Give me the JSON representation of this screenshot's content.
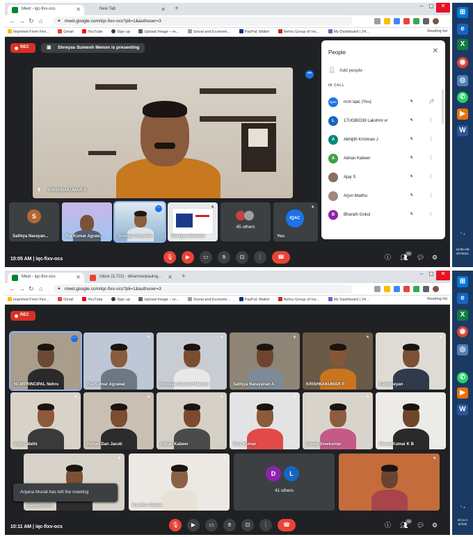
{
  "screens": [
    {
      "tabs": [
        {
          "title": "Meet - iqc-fixv-ocs"
        },
        {
          "title": "New Tab"
        }
      ],
      "url": "meet.google.com/iqc-fixv-ocs?pli=1&authuser=3",
      "bookmarks": [
        "Imported From Fire...",
        "Gmail",
        "YouTube",
        "Sign up",
        "Upload Image – re...",
        "Social and Economi...",
        "PayPal: Wallet",
        "Nehru Group of Ins...",
        "My Dashboard | 24..."
      ],
      "reading_list": "Reading list",
      "rec_label": "REC",
      "presenting_banner": "Shreyas Sumesh Menon is presenting",
      "main_speaker": "KRISHNAKUMAR P",
      "tiles": [
        {
          "name": "Sathiya Narayan...",
          "letter": "S"
        },
        {
          "name": "Raj Kumar Agraw..."
        },
        {
          "name": "Shreyas Sumesh"
        },
        {
          "name": "Shreyas Sumesh"
        },
        {
          "name": "45 others"
        },
        {
          "name": "You",
          "letter": "IQAC"
        }
      ],
      "time": "10:05 AM",
      "meeting_code": "iqc-fixv-ocs",
      "participant_count": "61",
      "people_panel": {
        "title": "People",
        "add_people": "Add people",
        "section": "IN CALL",
        "members": [
          {
            "name": "ncm iqac (You)",
            "avatar": "IQAC",
            "color": "#1a73e8"
          },
          {
            "name": "17UGBIO38 Lakshmi vr",
            "avatar": "L",
            "color": "#1565c0"
          },
          {
            "name": "Abhijith Krishnan J",
            "avatar": "A",
            "color": "#00897b"
          },
          {
            "name": "Adnan Kabeer",
            "avatar": "A",
            "color": "#43a047"
          },
          {
            "name": "Ajay S",
            "avatar": "",
            "color": "#8d6e63"
          },
          {
            "name": "Arjun Madhu",
            "avatar": "",
            "color": "#a1887f"
          },
          {
            "name": "Bharath Gokul",
            "avatar": "B",
            "color": "#8e24aa"
          }
        ]
      },
      "taskbar_clock": [
        "10:05 AM",
        "6/7/2021"
      ]
    },
    {
      "tabs": [
        {
          "title": "Meet - iqc-fixv-ocs"
        },
        {
          "title": "Inbox (3,722) - drkarmanpaulraj..."
        }
      ],
      "url": "meet.google.com/iqc-fixv-ocs?pli=1&authuser=3",
      "bookmarks": [
        "Imported From Fire...",
        "Gmail",
        "YouTube",
        "Sign up",
        "Upload Image – re...",
        "Social and Economi...",
        "PayPal: Wallet",
        "Nehru Group of Ins...",
        "My Dashboard | 24..."
      ],
      "reading_list": "Reading list",
      "rec_label": "REC",
      "grid": [
        {
          "name": "NCMPRINCIPAL Nehru"
        },
        {
          "name": "Raj Kumar Agrawal"
        },
        {
          "name": "Shreyas Sumesh Menon"
        },
        {
          "name": "Sathiya Narayanan A"
        },
        {
          "name": "KRISHNAKUMAR P"
        },
        {
          "name": "Karthikeyan"
        },
        {
          "name": "Indhu Mathi"
        },
        {
          "name": "Rohan Dan Jacob"
        },
        {
          "name": "Adnan Kabeer"
        },
        {
          "name": "Siva Kumar"
        },
        {
          "name": "Sreeja Sreekumar"
        },
        {
          "name": "Manoj Kumar K B"
        },
        {
          "name": "Naveen cool"
        },
        {
          "name": "Kavitha Vishak"
        },
        {
          "name": "41 others",
          "letters": [
            "D",
            "L"
          ]
        },
        {
          "name": ""
        }
      ],
      "toast": "Anjana Murali has left the meeting",
      "time": "10:11 AM",
      "meeting_code": "iqc-fixv-ocs",
      "participant_count": "64",
      "taskbar_clock": [
        "10:11 A",
        "6/7/20"
      ]
    }
  ]
}
